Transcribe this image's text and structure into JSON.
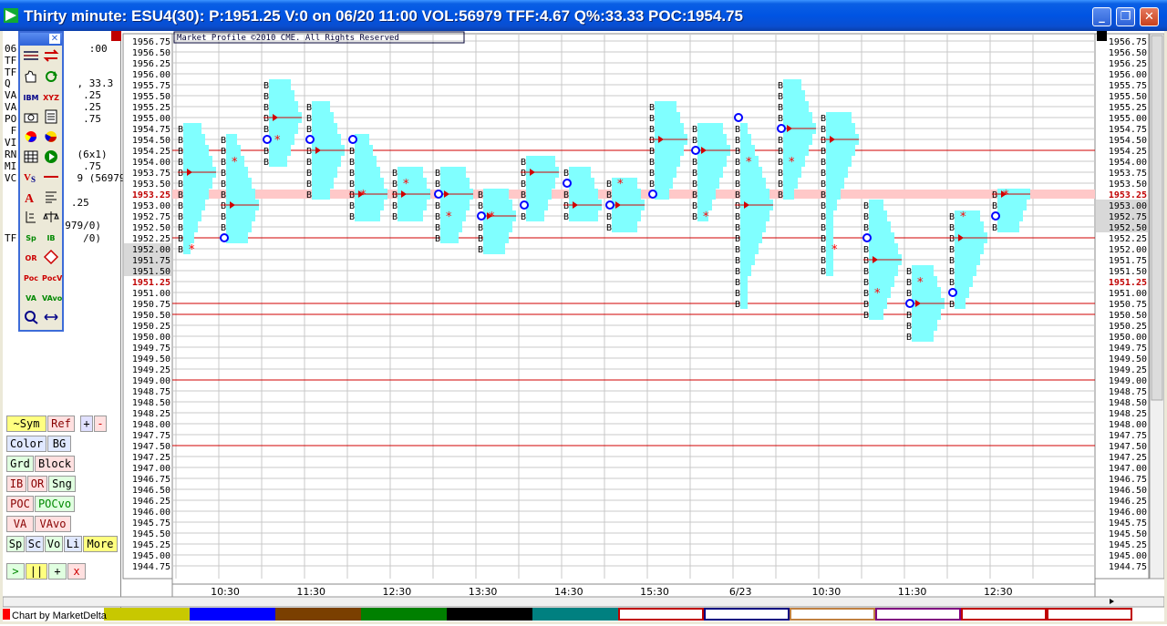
{
  "window": {
    "title": "Thirty minute: ESU4(30): P:1951.25 V:0 on 06/20 11:00 VOL:56979 TFF:4.67 Q%:33.33 POC:1954.75",
    "minimize": "_",
    "restore": "❐",
    "close": "✕"
  },
  "stats": {
    "partial_rows": [
      "06",
      ":00",
      "TF",
      "TF",
      "Q",
      ", 33.3",
      "VA",
      ".25",
      "VA",
      ".25",
      "PO",
      ".75",
      "F",
      "VI",
      "RN",
      "(6x1)",
      "MI",
      ".75",
      "VC",
      "9 (56979",
      ".25",
      "979/0)",
      "TF",
      "/0)"
    ]
  },
  "toolbox": {
    "close": "✕",
    "tools": [
      "IBM",
      "XYZ",
      "Sp",
      "IB",
      "OR",
      "Poc",
      "PocV",
      "VA",
      "VAvo"
    ]
  },
  "buttons": {
    "sym": "~Sym",
    "ref": "Ref",
    "plus": "+",
    "minus": "-",
    "color": "Color",
    "bg": "BG",
    "grd": "Grd",
    "block": "Block",
    "ib": "IB",
    "or": "OR",
    "sng": "Sng",
    "poc": "POC",
    "pocvo": "POCvo",
    "va": "VA",
    "vavo": "VAvo",
    "sp": "Sp",
    "sc": "Sc",
    "vo": "Vo",
    "li": "Li",
    "more": "More",
    "play": ">",
    "pause": "||",
    "add": "+",
    "del": "x"
  },
  "chart": {
    "copyright": "Market Profile ©2010 CME. All Rights Reserved",
    "credit": "Chart by MarketDelta",
    "colors": {
      "profile": "#80ffff",
      "grid": "#c8c8c8",
      "line": "#d00000",
      "poc_band": "#ffc8c8",
      "letter": "#000000",
      "open": "#0000ff",
      "star": "#ff0000"
    }
  },
  "chart_data": {
    "type": "market-profile",
    "ylim": [
      1944.75,
      1956.75
    ],
    "tick_step": 0.25,
    "left_highlight": [
      "1953.25",
      "1951.25"
    ],
    "left_shaded": [
      "1952.00",
      "1951.75",
      "1951.50"
    ],
    "right_highlight": [
      "1953.25",
      "1951.25"
    ],
    "right_shaded": [
      "1953.00",
      "1952.75",
      "1952.50"
    ],
    "x_labels": [
      "10:30",
      "11:30",
      "12:30",
      "13:30",
      "14:30",
      "15:30",
      "6/23",
      "10:30",
      "11:30",
      "12:30"
    ],
    "ref_lines": [
      1954.25,
      1952.25,
      1950.75,
      1950.5,
      1949.0,
      1947.5
    ],
    "poc_band": 1953.25,
    "periods": [
      {
        "lo": 1952.0,
        "hi": 1954.75,
        "poc": 1953.75,
        "open": null,
        "close": 1952.0
      },
      {
        "lo": 1952.25,
        "hi": 1954.5,
        "poc": 1953.0,
        "open": 1952.25,
        "close": 1954.0
      },
      {
        "lo": 1954.0,
        "hi": 1955.75,
        "poc": 1955.0,
        "open": 1954.5,
        "close": 1954.5
      },
      {
        "lo": 1953.25,
        "hi": 1955.25,
        "poc": 1954.25,
        "open": 1954.5,
        "close": null
      },
      {
        "lo": 1952.75,
        "hi": 1954.5,
        "poc": 1953.25,
        "open": 1954.5,
        "close": 1953.25
      },
      {
        "lo": 1952.75,
        "hi": 1953.75,
        "poc": 1953.25,
        "open": null,
        "close": 1953.5
      },
      {
        "lo": 1952.25,
        "hi": 1953.75,
        "poc": 1953.25,
        "open": 1953.25,
        "close": 1952.75
      },
      {
        "lo": 1952.0,
        "hi": 1953.25,
        "poc": 1952.75,
        "open": 1952.75,
        "close": 1952.75
      },
      {
        "lo": 1952.75,
        "hi": 1954.0,
        "poc": 1953.75,
        "open": 1953.0,
        "close": null
      },
      {
        "lo": 1952.75,
        "hi": 1953.75,
        "poc": 1953.0,
        "open": 1953.5,
        "close": null
      },
      {
        "lo": 1952.5,
        "hi": 1953.5,
        "poc": 1953.0,
        "open": 1953.0,
        "close": 1953.5
      },
      {
        "lo": 1953.25,
        "hi": 1955.25,
        "poc": 1954.5,
        "open": 1953.25,
        "close": null
      },
      {
        "lo": 1952.75,
        "hi": 1954.75,
        "poc": 1954.25,
        "open": 1954.25,
        "close": 1952.75
      },
      {
        "lo": 1950.75,
        "hi": 1954.75,
        "poc": 1953.0,
        "open": 1955.0,
        "close": 1954.0
      },
      {
        "lo": 1953.25,
        "hi": 1955.75,
        "poc": 1954.75,
        "open": 1954.75,
        "close": 1954.0
      },
      {
        "lo": 1951.5,
        "hi": 1955.0,
        "poc": 1954.5,
        "open": null,
        "close": 1952.0
      },
      {
        "lo": 1950.5,
        "hi": 1953.0,
        "poc": 1951.75,
        "open": 1952.25,
        "close": 1951.0
      },
      {
        "lo": 1950.0,
        "hi": 1951.5,
        "poc": 1950.75,
        "open": 1950.75,
        "close": 1951.25
      },
      {
        "lo": 1950.75,
        "hi": 1952.75,
        "poc": 1952.25,
        "open": 1951.0,
        "close": 1952.75
      },
      {
        "lo": 1952.5,
        "hi": 1953.25,
        "poc": 1953.25,
        "open": 1952.75,
        "close": 1953.25
      }
    ]
  }
}
